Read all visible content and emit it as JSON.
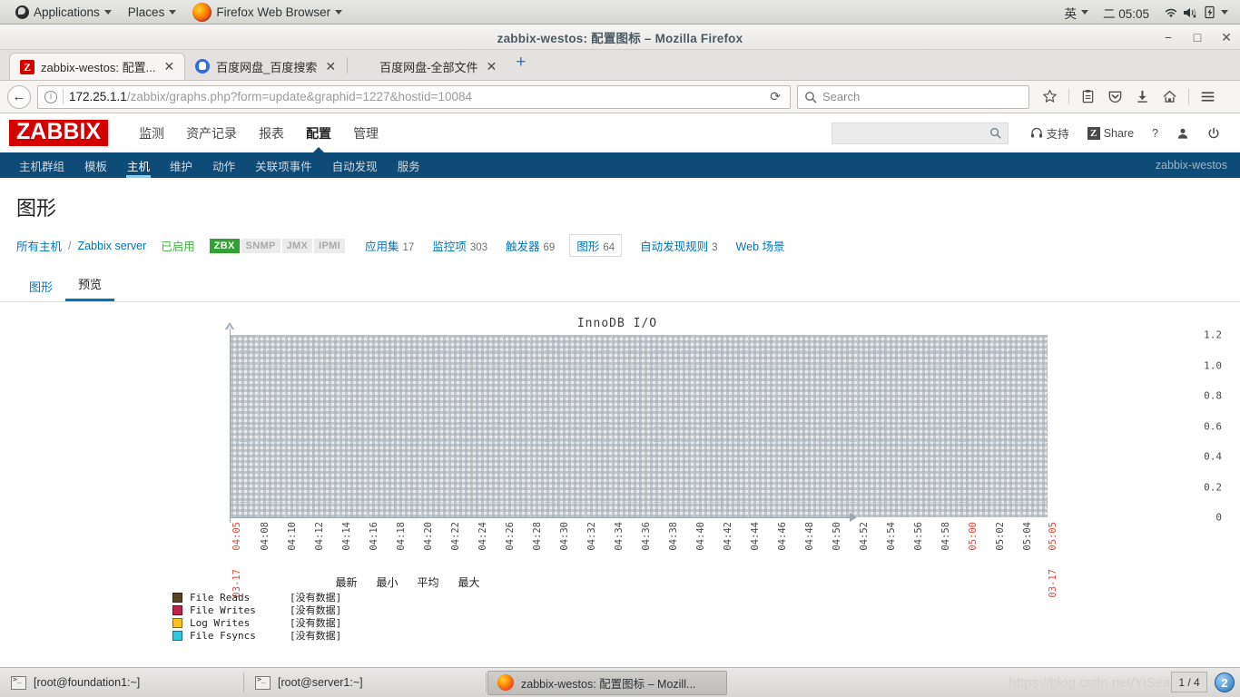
{
  "desktop": {
    "panel_left": [
      {
        "label": "Applications",
        "icon": "fedora-logo",
        "caret": true
      },
      {
        "label": "Places",
        "icon": "",
        "caret": true
      },
      {
        "label": "Firefox Web Browser",
        "icon": "firefox-logo",
        "caret": true
      }
    ],
    "panel_right": {
      "input_method": "英",
      "clock": "二 05:05",
      "icons": [
        "wifi-icon",
        "volume-muted-icon",
        "battery-icon",
        "chevron-down-icon"
      ]
    }
  },
  "window": {
    "title": "zabbix-westos: 配置图标 – Mozilla Firefox",
    "controls": {
      "minimize": "−",
      "maximize": "□",
      "close": "✕"
    }
  },
  "tabs": [
    {
      "label": "zabbix-westos: 配置...",
      "favicon": "zabbix-icon",
      "active": true,
      "close": "✕"
    },
    {
      "label": "百度网盘_百度搜索",
      "favicon": "baidu-icon",
      "active": false,
      "close": "✕"
    },
    {
      "label": "百度网盘-全部文件",
      "favicon": "blank-icon",
      "active": false,
      "close": "✕"
    }
  ],
  "newtab_label": "+",
  "navbar": {
    "back_glyph": "←",
    "url_host": "172.25.1.1",
    "url_path": "/zabbix/graphs.php?form=update&graphid=1227&hostid=10084",
    "reload_glyph": "⟳",
    "search_placeholder": "Search",
    "icons": [
      "star-icon",
      "library-icon",
      "pocket-icon",
      "download-icon",
      "home-icon",
      "menu-icon"
    ]
  },
  "zabbix": {
    "logo": "ZABBIX",
    "topmenu": [
      {
        "label": "监测",
        "active": false
      },
      {
        "label": "资产记录",
        "active": false
      },
      {
        "label": "报表",
        "active": false
      },
      {
        "label": "配置",
        "active": true
      },
      {
        "label": "管理",
        "active": false
      }
    ],
    "header_right": {
      "search_value": "",
      "support_label": "支持",
      "share_label": "Share",
      "share_badge": "Z",
      "help_label": "?",
      "user_icon": "user-icon",
      "logout_icon": "power-icon"
    },
    "submenu": [
      {
        "label": "主机群组",
        "active": false
      },
      {
        "label": "模板",
        "active": false
      },
      {
        "label": "主机",
        "active": true
      },
      {
        "label": "维护",
        "active": false
      },
      {
        "label": "动作",
        "active": false
      },
      {
        "label": "关联项事件",
        "active": false
      },
      {
        "label": "自动发现",
        "active": false
      },
      {
        "label": "服务",
        "active": false
      }
    ],
    "current_user": "zabbix-westos",
    "page_title": "图形",
    "breadcrumb": {
      "all_hosts": "所有主机",
      "separator": "/",
      "host": "Zabbix server",
      "enabled": "已启用",
      "protocols": [
        {
          "label": "ZBX",
          "on": true
        },
        {
          "label": "SNMP",
          "on": false
        },
        {
          "label": "JMX",
          "on": false
        },
        {
          "label": "IPMI",
          "on": false
        }
      ],
      "counts": [
        {
          "label": "应用集",
          "count": "17",
          "selected": false
        },
        {
          "label": "监控项",
          "count": "303",
          "selected": false
        },
        {
          "label": "触发器",
          "count": "69",
          "selected": false
        },
        {
          "label": "图形",
          "count": "64",
          "selected": true
        },
        {
          "label": "自动发现规则",
          "count": "3",
          "selected": false
        },
        {
          "label": "Web 场景",
          "count": "",
          "selected": false
        }
      ]
    },
    "tabs": [
      {
        "label": "图形",
        "active": false
      },
      {
        "label": "预览",
        "active": true
      }
    ]
  },
  "chart_data": {
    "type": "line",
    "title": "InnoDB I/O",
    "xlabel": "",
    "ylabel": "",
    "ylim": [
      0,
      1.2
    ],
    "yticks": [
      "0",
      "0.2",
      "0.4",
      "0.6",
      "0.8",
      "1.0",
      "1.2"
    ],
    "grid": true,
    "legend_position": "bottom",
    "xticks": [
      {
        "time": "04:05",
        "date": "03-17",
        "highlight": true
      },
      {
        "time": "04:08",
        "date": "",
        "highlight": false
      },
      {
        "time": "04:10",
        "date": "",
        "highlight": false
      },
      {
        "time": "04:12",
        "date": "",
        "highlight": false
      },
      {
        "time": "04:14",
        "date": "",
        "highlight": false
      },
      {
        "time": "04:16",
        "date": "",
        "highlight": false
      },
      {
        "time": "04:18",
        "date": "",
        "highlight": false
      },
      {
        "time": "04:20",
        "date": "",
        "highlight": false
      },
      {
        "time": "04:22",
        "date": "",
        "highlight": false
      },
      {
        "time": "04:24",
        "date": "",
        "highlight": false
      },
      {
        "time": "04:26",
        "date": "",
        "highlight": false
      },
      {
        "time": "04:28",
        "date": "",
        "highlight": false
      },
      {
        "time": "04:30",
        "date": "",
        "highlight": false
      },
      {
        "time": "04:32",
        "date": "",
        "highlight": false
      },
      {
        "time": "04:34",
        "date": "",
        "highlight": false
      },
      {
        "time": "04:36",
        "date": "",
        "highlight": false
      },
      {
        "time": "04:38",
        "date": "",
        "highlight": false
      },
      {
        "time": "04:40",
        "date": "",
        "highlight": false
      },
      {
        "time": "04:42",
        "date": "",
        "highlight": false
      },
      {
        "time": "04:44",
        "date": "",
        "highlight": false
      },
      {
        "time": "04:46",
        "date": "",
        "highlight": false
      },
      {
        "time": "04:48",
        "date": "",
        "highlight": false
      },
      {
        "time": "04:50",
        "date": "",
        "highlight": false
      },
      {
        "time": "04:52",
        "date": "",
        "highlight": false
      },
      {
        "time": "04:54",
        "date": "",
        "highlight": false
      },
      {
        "time": "04:56",
        "date": "",
        "highlight": false
      },
      {
        "time": "04:58",
        "date": "",
        "highlight": false
      },
      {
        "time": "05:00",
        "date": "",
        "highlight": true
      },
      {
        "time": "05:02",
        "date": "",
        "highlight": false
      },
      {
        "time": "05:04",
        "date": "",
        "highlight": false
      },
      {
        "time": "05:05",
        "date": "03-17",
        "highlight": true
      }
    ],
    "legend_headers": [
      "最新",
      "最小",
      "平均",
      "最大"
    ],
    "series": [
      {
        "name": "File Reads",
        "color": "#5b4426",
        "values": [],
        "no_data": "[没有数据]"
      },
      {
        "name": "File Writes",
        "color": "#c3214a",
        "values": [],
        "no_data": "[没有数据]"
      },
      {
        "name": "Log Writes",
        "color": "#fbc21b",
        "values": [],
        "no_data": "[没有数据]"
      },
      {
        "name": "File Fsyncs",
        "color": "#2fc9dc",
        "values": [],
        "no_data": "[没有数据]"
      }
    ]
  },
  "taskbar": {
    "tasks": [
      {
        "label": "[root@foundation1:~]",
        "icon": "terminal-icon",
        "active": false
      },
      {
        "label": "[root@server1:~]",
        "icon": "terminal-icon",
        "active": false
      },
      {
        "label": "zabbix-westos: 配置图标 – Mozill...",
        "icon": "firefox-icon",
        "active": true
      }
    ],
    "watermark": "https://blog.csdn.net/YiSeang",
    "workspace": "1 / 4",
    "badge": "2"
  }
}
